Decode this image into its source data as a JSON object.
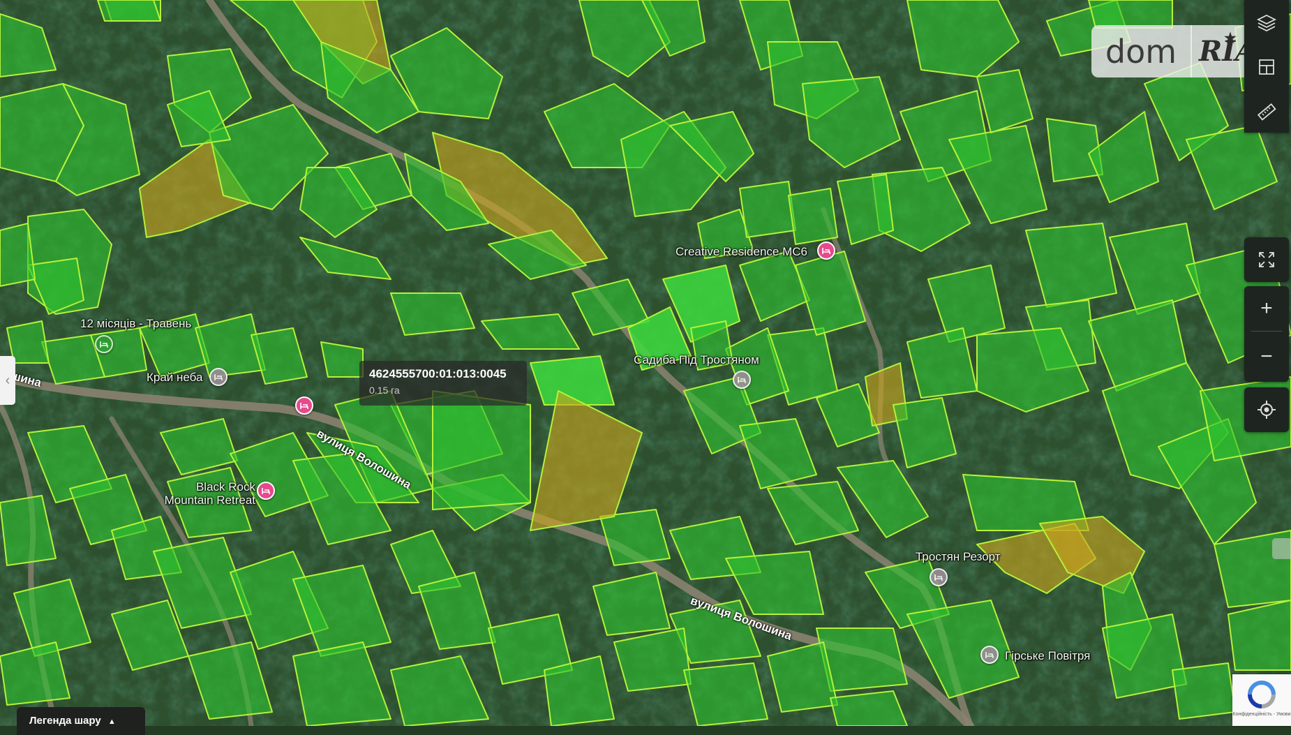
{
  "map": {
    "parcel_colors": {
      "green": "#2fc12f",
      "bright_green": "#3ddc3d",
      "yellow": "#c9a41e",
      "outline": "#b6f23a"
    },
    "roads_color": "#8a8070",
    "selected_parcel": {
      "cadastral_number": "4624555700:01:013:0045",
      "area": "0.15 га"
    }
  },
  "pois": [
    {
      "name": "12 місяців - Травень",
      "marker": "green"
    },
    {
      "name": "Край неба",
      "marker": "grey"
    },
    {
      "name": "Creative Residence MC6",
      "marker": "pink"
    },
    {
      "name": "Садиба Під Тростяном",
      "marker": "grey"
    },
    {
      "name": "Black Rock Mountain Retreat",
      "marker": "pink"
    },
    {
      "name": "Тростян Резорт",
      "marker": "grey"
    },
    {
      "name": "Гірське Повітря",
      "marker": "grey"
    }
  ],
  "unlabeled_marker": {
    "marker": "pink"
  },
  "streets": [
    {
      "name": "вулиця Волошина"
    },
    {
      "name": "вулиця Волошина"
    },
    {
      "name": "шина"
    }
  ],
  "logo": {
    "part1": "dom",
    "part2": "RIA"
  },
  "controls": {
    "top": [
      "layers-icon",
      "cadastre-icon",
      "ruler-icon"
    ],
    "fullscreen": "fullscreen-icon",
    "zoom_in": "+",
    "zoom_out": "−",
    "locate": "locate-icon"
  },
  "legend": {
    "label": "Легенда шару"
  },
  "side_tab": {
    "arrow": "‹"
  },
  "recaptcha": {
    "text": "Конфіденційність - Умови"
  }
}
